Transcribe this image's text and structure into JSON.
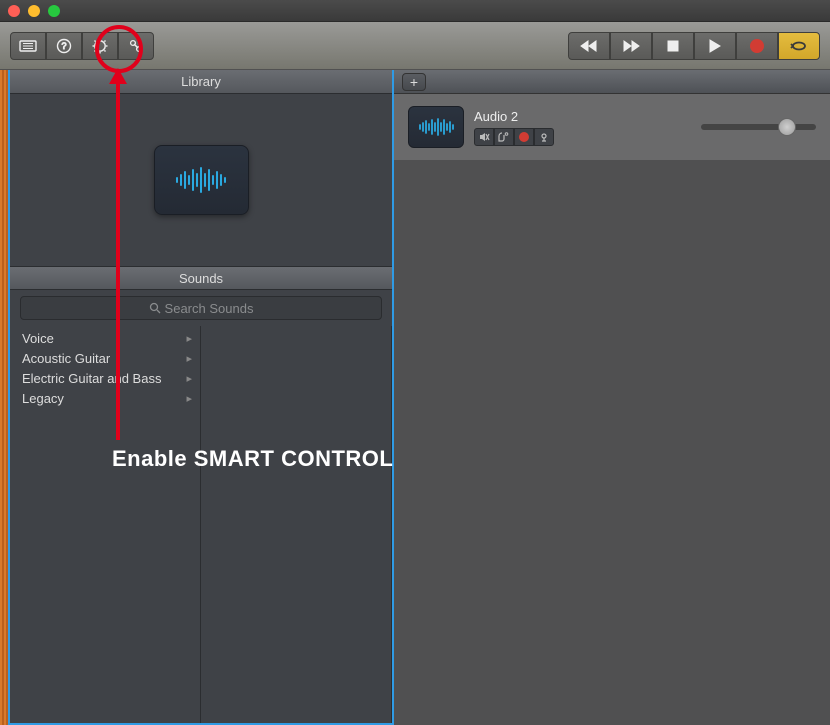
{
  "traffic": {
    "close": "close",
    "min": "minimize",
    "max": "maximize"
  },
  "toolbar": {
    "library_icon": "library-icon",
    "help_icon": "help-icon",
    "smart_icon": "smart-controls-icon",
    "editors_icon": "editors-icon",
    "rewind": "rewind",
    "forward": "forward",
    "stop": "stop",
    "play": "play",
    "record": "record",
    "cycle": "cycle"
  },
  "library": {
    "title": "Library",
    "sounds_title": "Sounds",
    "search_placeholder": "Search Sounds",
    "categories": [
      {
        "label": "Voice"
      },
      {
        "label": "Acoustic Guitar"
      },
      {
        "label": "Electric Guitar and Bass"
      },
      {
        "label": "Legacy"
      }
    ]
  },
  "tracks": {
    "add": "+",
    "rows": [
      {
        "name": "Audio 2",
        "buttons": {
          "mute": "mute",
          "solo": "solo",
          "rec": "rec-enable",
          "input": "input-monitor"
        },
        "volume_pct": 75
      }
    ]
  },
  "annotation": {
    "text": "Enable SMART CONTROL"
  },
  "colors": {
    "accent": "#2f9be5",
    "record": "#d23c33",
    "cycle": "#d8ad31",
    "wave": "#2aa9e0"
  }
}
